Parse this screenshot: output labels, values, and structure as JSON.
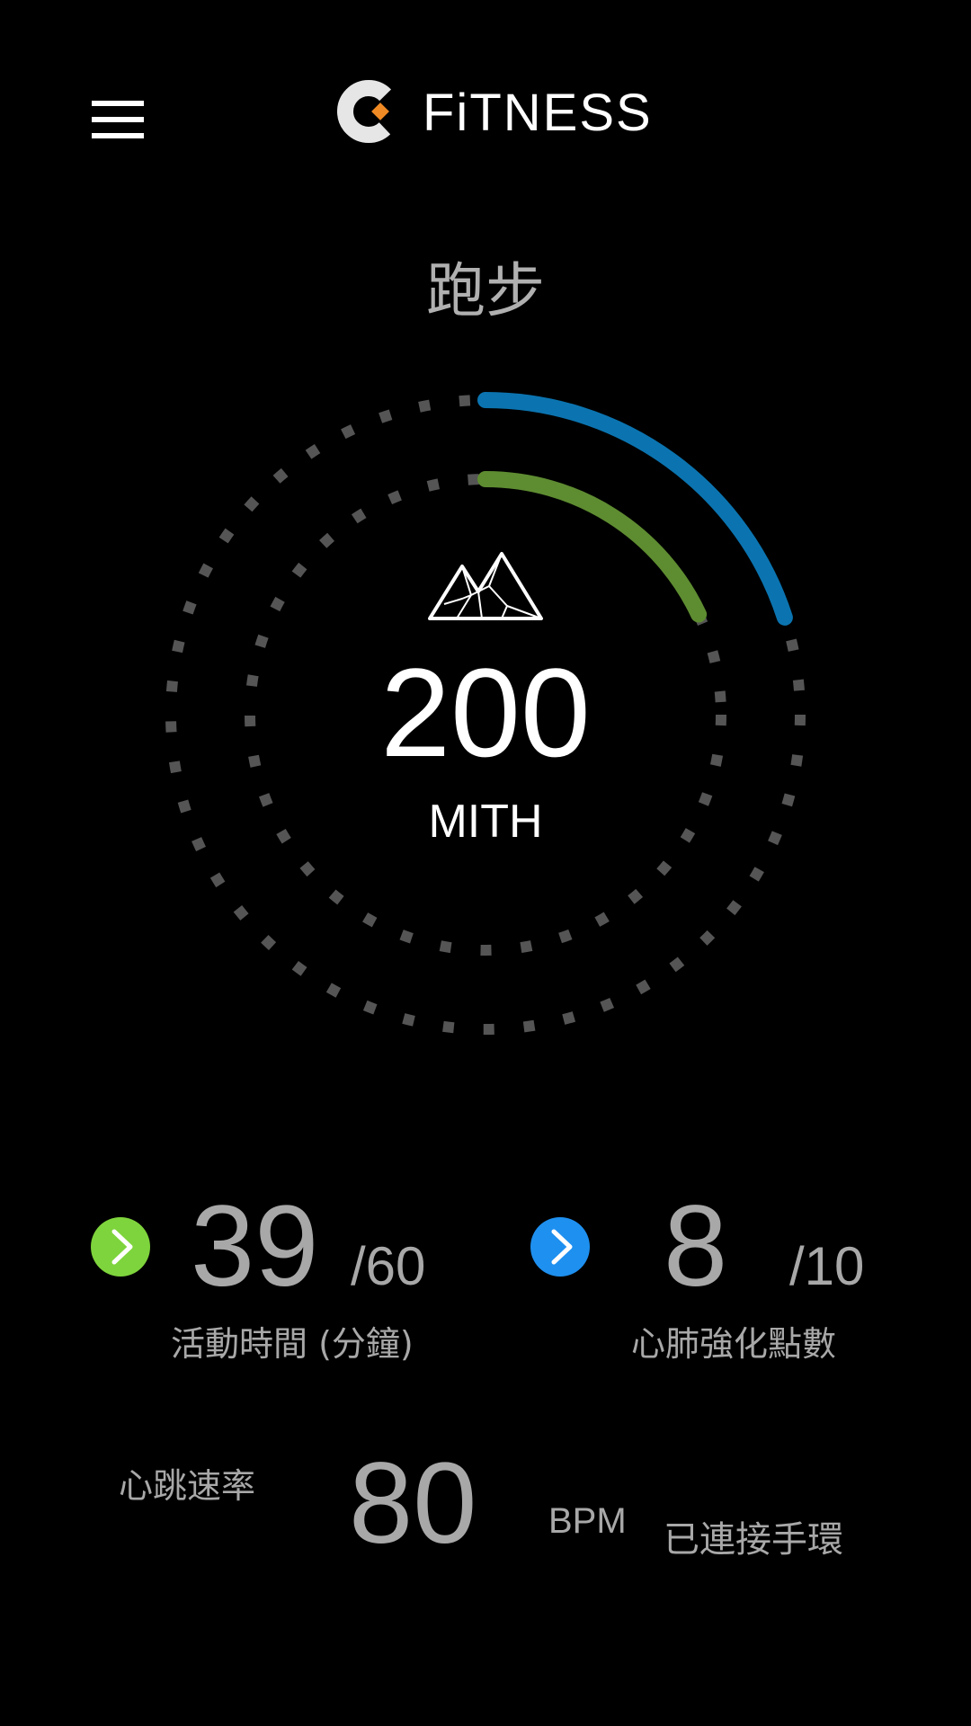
{
  "header": {
    "menu_icon": "hamburger-menu-icon",
    "logo_icon": "c-logo-icon",
    "brand": "FiTNESS"
  },
  "activity": {
    "title": "跑步",
    "value": "200",
    "unit": "MITH",
    "icon": "mountain-icon",
    "progress": {
      "outer_fraction": 0.2,
      "inner_fraction": 0.18,
      "outer_color": "#0b74b0",
      "inner_color": "#5e8c31",
      "track_color": "#555555"
    }
  },
  "stats": [
    {
      "arrow_icon": "chevron-right-icon",
      "arrow_color": "#7ed43c",
      "value": "39",
      "goal": "/60",
      "label": "活動時間 (分鐘)"
    },
    {
      "arrow_icon": "chevron-right-icon",
      "arrow_color": "#1e90f0",
      "value": "8",
      "goal": "/10",
      "label": "心肺強化點數"
    }
  ],
  "heart": {
    "label": "心跳速率",
    "value": "80",
    "unit": "BPM",
    "status": "已連接手環"
  }
}
